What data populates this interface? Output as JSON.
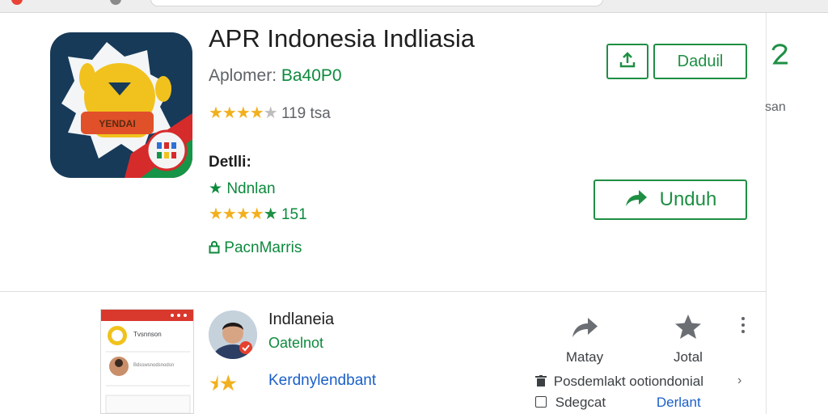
{
  "browser": {},
  "app": {
    "title": "APR Indonesia Indliasia",
    "developer_prefix": "Aplomer:",
    "developer_link": "Ba40P0",
    "rating_count": "119",
    "rating_suffix": "tsa",
    "rating_stars": 4,
    "icon_banner_text": "YENDAI"
  },
  "details": {
    "label": "Detlli:",
    "item_star_text": "Ndnlan",
    "item_rating_value": "151",
    "item_lock_text": "PacnMarris"
  },
  "buttons": {
    "download_small_label": "Daduil",
    "unduh_label": "Unduh"
  },
  "side": {
    "text": "san"
  },
  "screenshot_preview": {
    "row1": "Tvsnnson",
    "row2": "Bdsswsnodsnodsn"
  },
  "review": {
    "name": "Indlaneia",
    "subtitle": "Oatelnot",
    "link": "Kerdnylendbant"
  },
  "actions": {
    "share_label": "Matay",
    "favorite_label": "Jotal"
  },
  "meta": {
    "row1_left": "Posdemlakt",
    "row1_right": "ootiondonial",
    "row2_left": "Sdegcat",
    "row2_right": "Derlant"
  },
  "colors": {
    "accent_green": "#1f8f44",
    "star": "#f2b01e",
    "link_blue": "#1a5fc8",
    "icon_bg": "#173a59"
  }
}
